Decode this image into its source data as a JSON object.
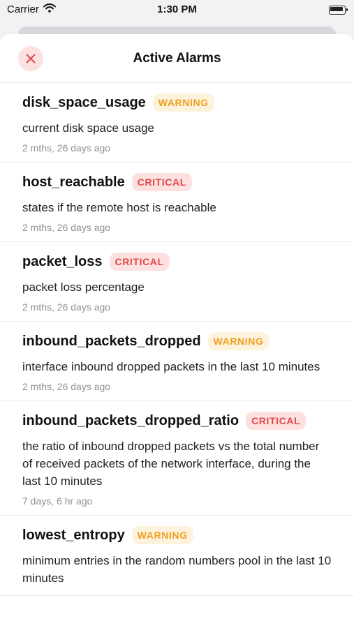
{
  "status_bar": {
    "carrier": "Carrier",
    "time": "1:30 PM",
    "wifi_icon": "wifi-icon",
    "battery_icon": "battery-icon"
  },
  "sheet": {
    "title": "Active Alarms",
    "close_icon": "close-icon",
    "close_color": "#e34848"
  },
  "colors": {
    "warning_text": "#f0a020",
    "warning_bg": "#fdf3dd",
    "critical_text": "#e34848",
    "critical_bg": "#fde1e1"
  },
  "alarms": [
    {
      "name": "disk_space_usage",
      "severity": "WARNING",
      "description": "current disk space usage",
      "time": "2 mths, 26 days ago"
    },
    {
      "name": "host_reachable",
      "severity": "CRITICAL",
      "description": "states if the remote host is reachable",
      "time": "2 mths, 26 days ago"
    },
    {
      "name": "packet_loss",
      "severity": "CRITICAL",
      "description": "packet loss percentage",
      "time": "2 mths, 26 days ago"
    },
    {
      "name": "inbound_packets_dropped",
      "severity": "WARNING",
      "description": "interface inbound dropped packets in the last 10 minutes",
      "time": "2 mths, 26 days ago"
    },
    {
      "name": "inbound_packets_dropped_ratio",
      "severity": "CRITICAL",
      "description": "the ratio of inbound dropped packets vs the total number of received packets of the network interface, during the last 10 minutes",
      "time": "7 days, 6 hr ago"
    },
    {
      "name": "lowest_entropy",
      "severity": "WARNING",
      "description": "minimum entries in the random numbers pool in the last 10 minutes",
      "time": ""
    }
  ]
}
